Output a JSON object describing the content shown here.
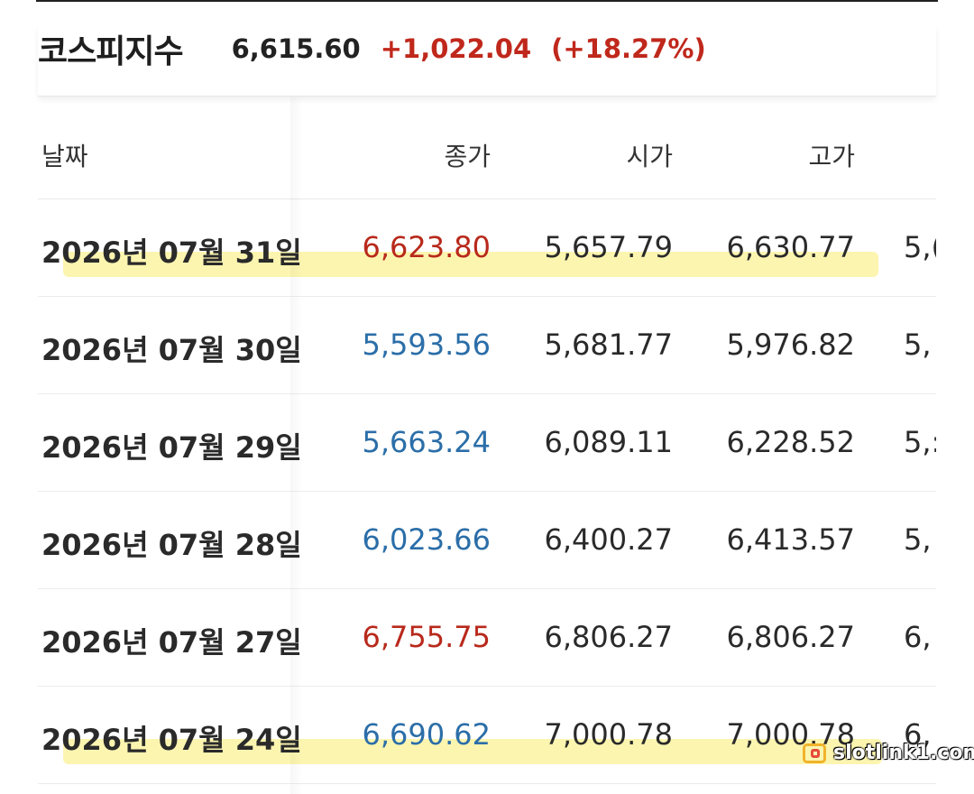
{
  "header": {
    "index_name": "코스피지수",
    "price": "6,615.60",
    "change": "+1,022.04",
    "change_pct": "(+18.27%)"
  },
  "table": {
    "columns": [
      "날짜",
      "종가",
      "시가",
      "고가"
    ],
    "rows": [
      {
        "date": "2026년 07월 31일",
        "close": "6,623.80",
        "close_dir": "up",
        "open": "5,657.79",
        "high": "6,630.77",
        "low_partial": "5,(",
        "highlighted": true
      },
      {
        "date": "2026년 07월 30일",
        "close": "5,593.56",
        "close_dir": "down",
        "open": "5,681.77",
        "high": "5,976.82",
        "low_partial": "5,",
        "highlighted": false
      },
      {
        "date": "2026년 07월 29일",
        "close": "5,663.24",
        "close_dir": "down",
        "open": "6,089.11",
        "high": "6,228.52",
        "low_partial": "5,:",
        "highlighted": false
      },
      {
        "date": "2026년 07월 28일",
        "close": "6,023.66",
        "close_dir": "down",
        "open": "6,400.27",
        "high": "6,413.57",
        "low_partial": "5,",
        "highlighted": false
      },
      {
        "date": "2026년 07월 27일",
        "close": "6,755.75",
        "close_dir": "up",
        "open": "6,806.27",
        "high": "6,806.27",
        "low_partial": "6,",
        "highlighted": false
      },
      {
        "date": "2026년 07월 24일",
        "close": "6,690.62",
        "close_dir": "down",
        "open": "7,000.78",
        "high": "7,000.78",
        "low_partial": "6,",
        "highlighted": true
      }
    ]
  },
  "watermark": {
    "text": "slotlink1.com"
  },
  "colors": {
    "up": "#b8291b",
    "down": "#2b6ea8",
    "highlight": "#fbf3a2"
  }
}
